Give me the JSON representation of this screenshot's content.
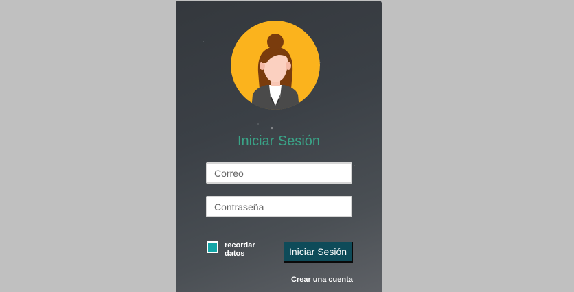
{
  "login": {
    "title": "Iniciar Sesión",
    "email": {
      "placeholder": "Correo",
      "value": ""
    },
    "password": {
      "placeholder": "Contraseña",
      "value": ""
    },
    "remember_label": "recordar datos",
    "remember_checked": false,
    "submit_label": "Iniciar Sesión",
    "create_account_label": "Crear una cuenta"
  },
  "colors": {
    "background": "#c0c0c0",
    "title": "#3aa387",
    "button": "#0e4b59",
    "checkbox": "#13a5a7",
    "avatar_bg": "#fbb31d"
  },
  "icons": {
    "avatar": "woman-user-avatar-icon"
  }
}
